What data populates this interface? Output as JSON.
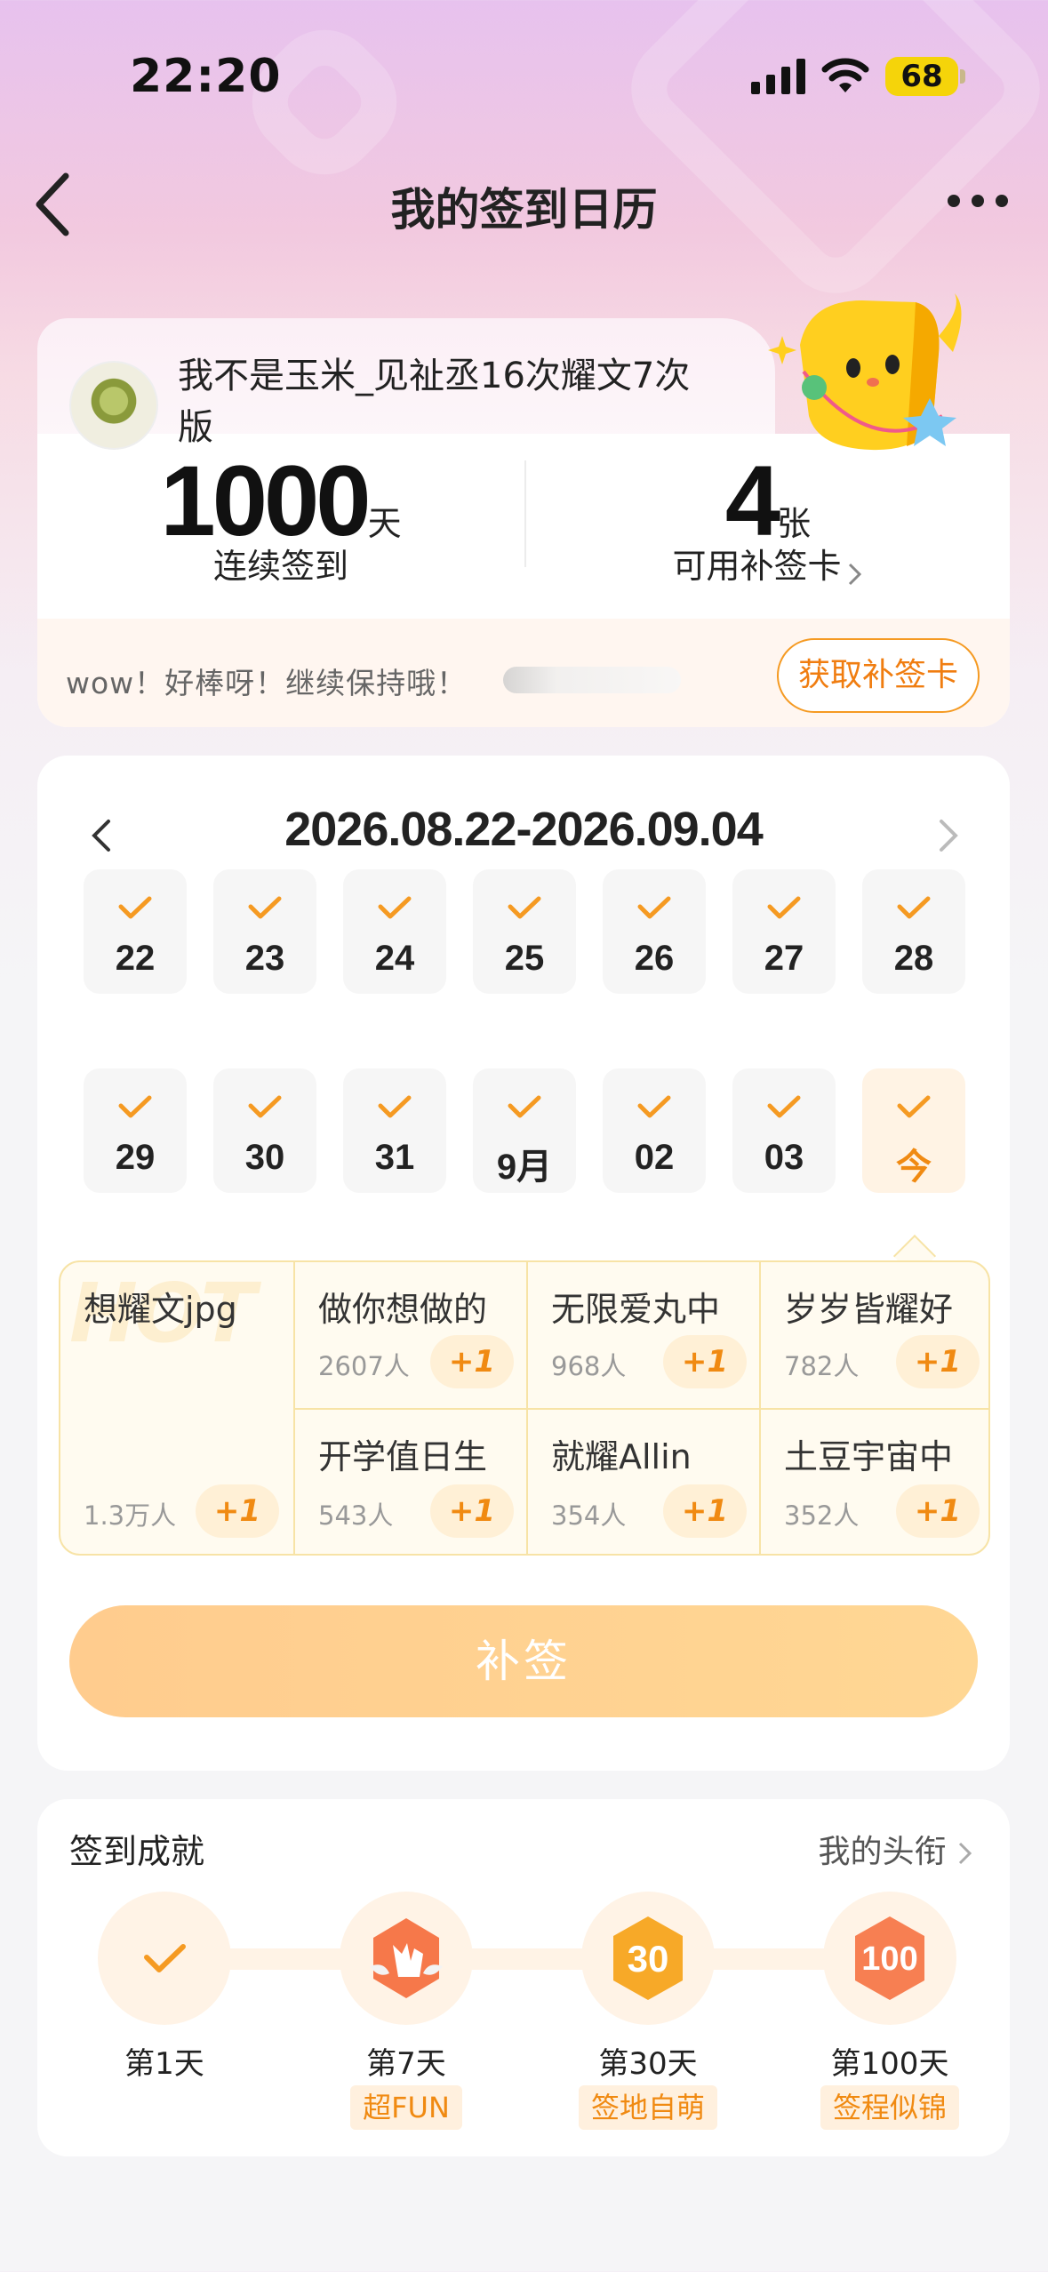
{
  "status_bar": {
    "time": "22:20",
    "battery": "68"
  },
  "nav": {
    "title": "我的签到日历"
  },
  "profile": {
    "name": "我不是玉米_见祉丞16次耀文7次版",
    "streak_value": "1000",
    "streak_unit": "天",
    "streak_label": "连续签到",
    "cards_value": "4",
    "cards_unit": "张",
    "cards_label": "可用补签卡",
    "encourage": "wow！好棒呀！继续保持哦！",
    "get_card_label": "获取补签卡"
  },
  "calendar": {
    "range": "2026.08.22-2026.09.04",
    "days": [
      "22",
      "23",
      "24",
      "25",
      "26",
      "27",
      "28",
      "29",
      "30",
      "31",
      "9月",
      "02",
      "03",
      "今"
    ]
  },
  "topics": {
    "hot_label": "HOT",
    "featured": {
      "name": "想耀文jpg",
      "count": "1.3万人",
      "plus": "+1"
    },
    "items": [
      {
        "name": "做你想做的",
        "count": "2607人",
        "plus": "+1"
      },
      {
        "name": "无限爱丸中",
        "count": "968人",
        "plus": "+1"
      },
      {
        "name": "岁岁皆耀好",
        "count": "782人",
        "plus": "+1"
      },
      {
        "name": "开学值日生",
        "count": "543人",
        "plus": "+1"
      },
      {
        "name": "就耀Allin",
        "count": "354人",
        "plus": "+1"
      },
      {
        "name": "土豆宇宙中",
        "count": "352人",
        "plus": "+1"
      }
    ]
  },
  "resign_label": "补签",
  "achievements": {
    "title": "签到成就",
    "link": "我的头衔",
    "items": [
      {
        "label": "第1天",
        "tag": ""
      },
      {
        "label": "第7天",
        "tag": "超FUN"
      },
      {
        "label": "第30天",
        "tag": "签地自萌"
      },
      {
        "label": "第100天",
        "tag": "签程似锦"
      }
    ]
  },
  "colors": {
    "accent": "#f08a12",
    "check": "#f59a22",
    "button": "#ffd08f"
  }
}
